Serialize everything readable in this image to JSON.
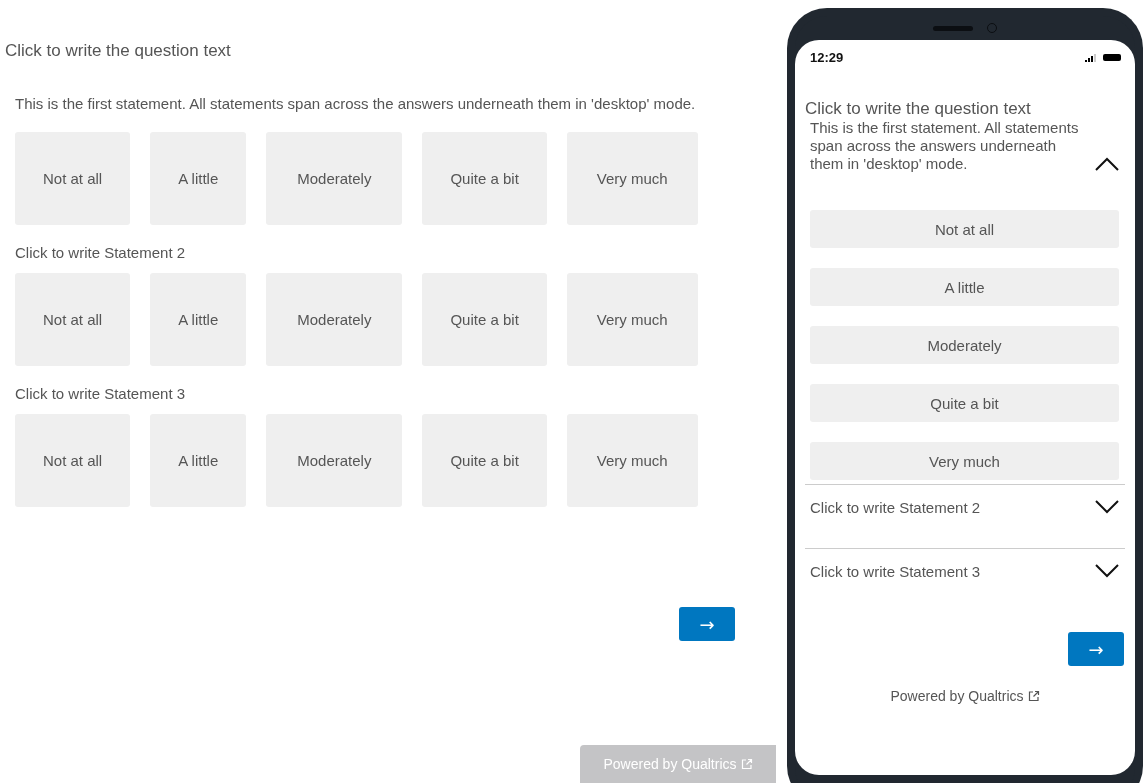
{
  "desktop": {
    "question": "Click to write the question text",
    "statements": [
      {
        "text": "This is the first statement. All statements span across the answers underneath them in 'desktop' mode.",
        "answers": [
          "Not at all",
          "A little",
          "Moderately",
          "Quite a bit",
          "Very much"
        ]
      },
      {
        "text": "Click to write Statement 2",
        "answers": [
          "Not at all",
          "A little",
          "Moderately",
          "Quite a bit",
          "Very much"
        ]
      },
      {
        "text": "Click to write Statement 3",
        "answers": [
          "Not at all",
          "A little",
          "Moderately",
          "Quite a bit",
          "Very much"
        ]
      }
    ],
    "next_button": "→",
    "footer": "Powered by Qualtrics"
  },
  "mobile": {
    "time": "12:29",
    "question": "Click to write the question text",
    "statements": [
      {
        "text": "This is the first statement. All statements span across the answers underneath them in 'desktop' mode.",
        "expanded": true,
        "answers": [
          "Not at all",
          "A little",
          "Moderately",
          "Quite a bit",
          "Very much"
        ]
      },
      {
        "text": "Click to write Statement 2",
        "expanded": false
      },
      {
        "text": "Click to write Statement 3",
        "expanded": false
      }
    ],
    "next_button": "→",
    "footer": "Powered by Qualtrics"
  }
}
